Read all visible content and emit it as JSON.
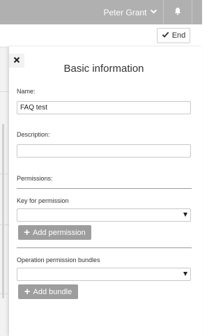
{
  "topbar": {
    "user_name": "Peter Grant",
    "user_icon": "chevron-down-icon",
    "bell_icon": "bell-icon"
  },
  "toolbar": {
    "end_label": "End",
    "end_icon": "checkmark-icon"
  },
  "panel": {
    "close_icon": "close-icon",
    "title": "Basic information",
    "name_label": "Name:",
    "name_value": "FAQ test",
    "description_label": "Description:",
    "description_value": "",
    "permissions_label": "Permissions:",
    "key_label": "Key for permission",
    "add_permission_label": "Add permission",
    "bundles_label": "Operation permission bundles",
    "add_bundle_label": "Add bundle"
  },
  "colors": {
    "topbar": "#b0b0b0",
    "button_gray": "#9d9d9d"
  }
}
